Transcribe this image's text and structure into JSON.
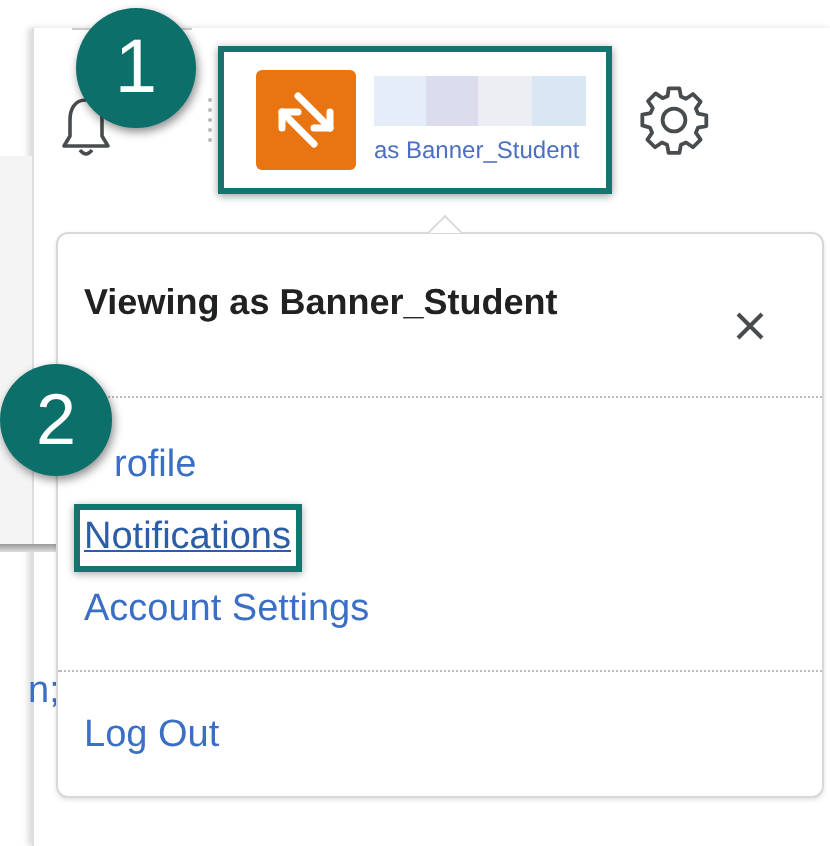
{
  "header": {
    "user_chip": {
      "caption": "as Banner_Student",
      "highlighted": true
    }
  },
  "menu": {
    "title": "Viewing as Banner_Student",
    "sections": [
      [
        {
          "label": "rofile",
          "highlighted": false
        },
        {
          "label": "Notifications",
          "highlighted": true
        },
        {
          "label": "Account Settings",
          "highlighted": false
        }
      ],
      [
        {
          "label": "Log Out",
          "highlighted": false
        }
      ]
    ]
  },
  "background_text": "n;",
  "callouts": [
    {
      "label": "1"
    },
    {
      "label": "2"
    }
  ]
}
